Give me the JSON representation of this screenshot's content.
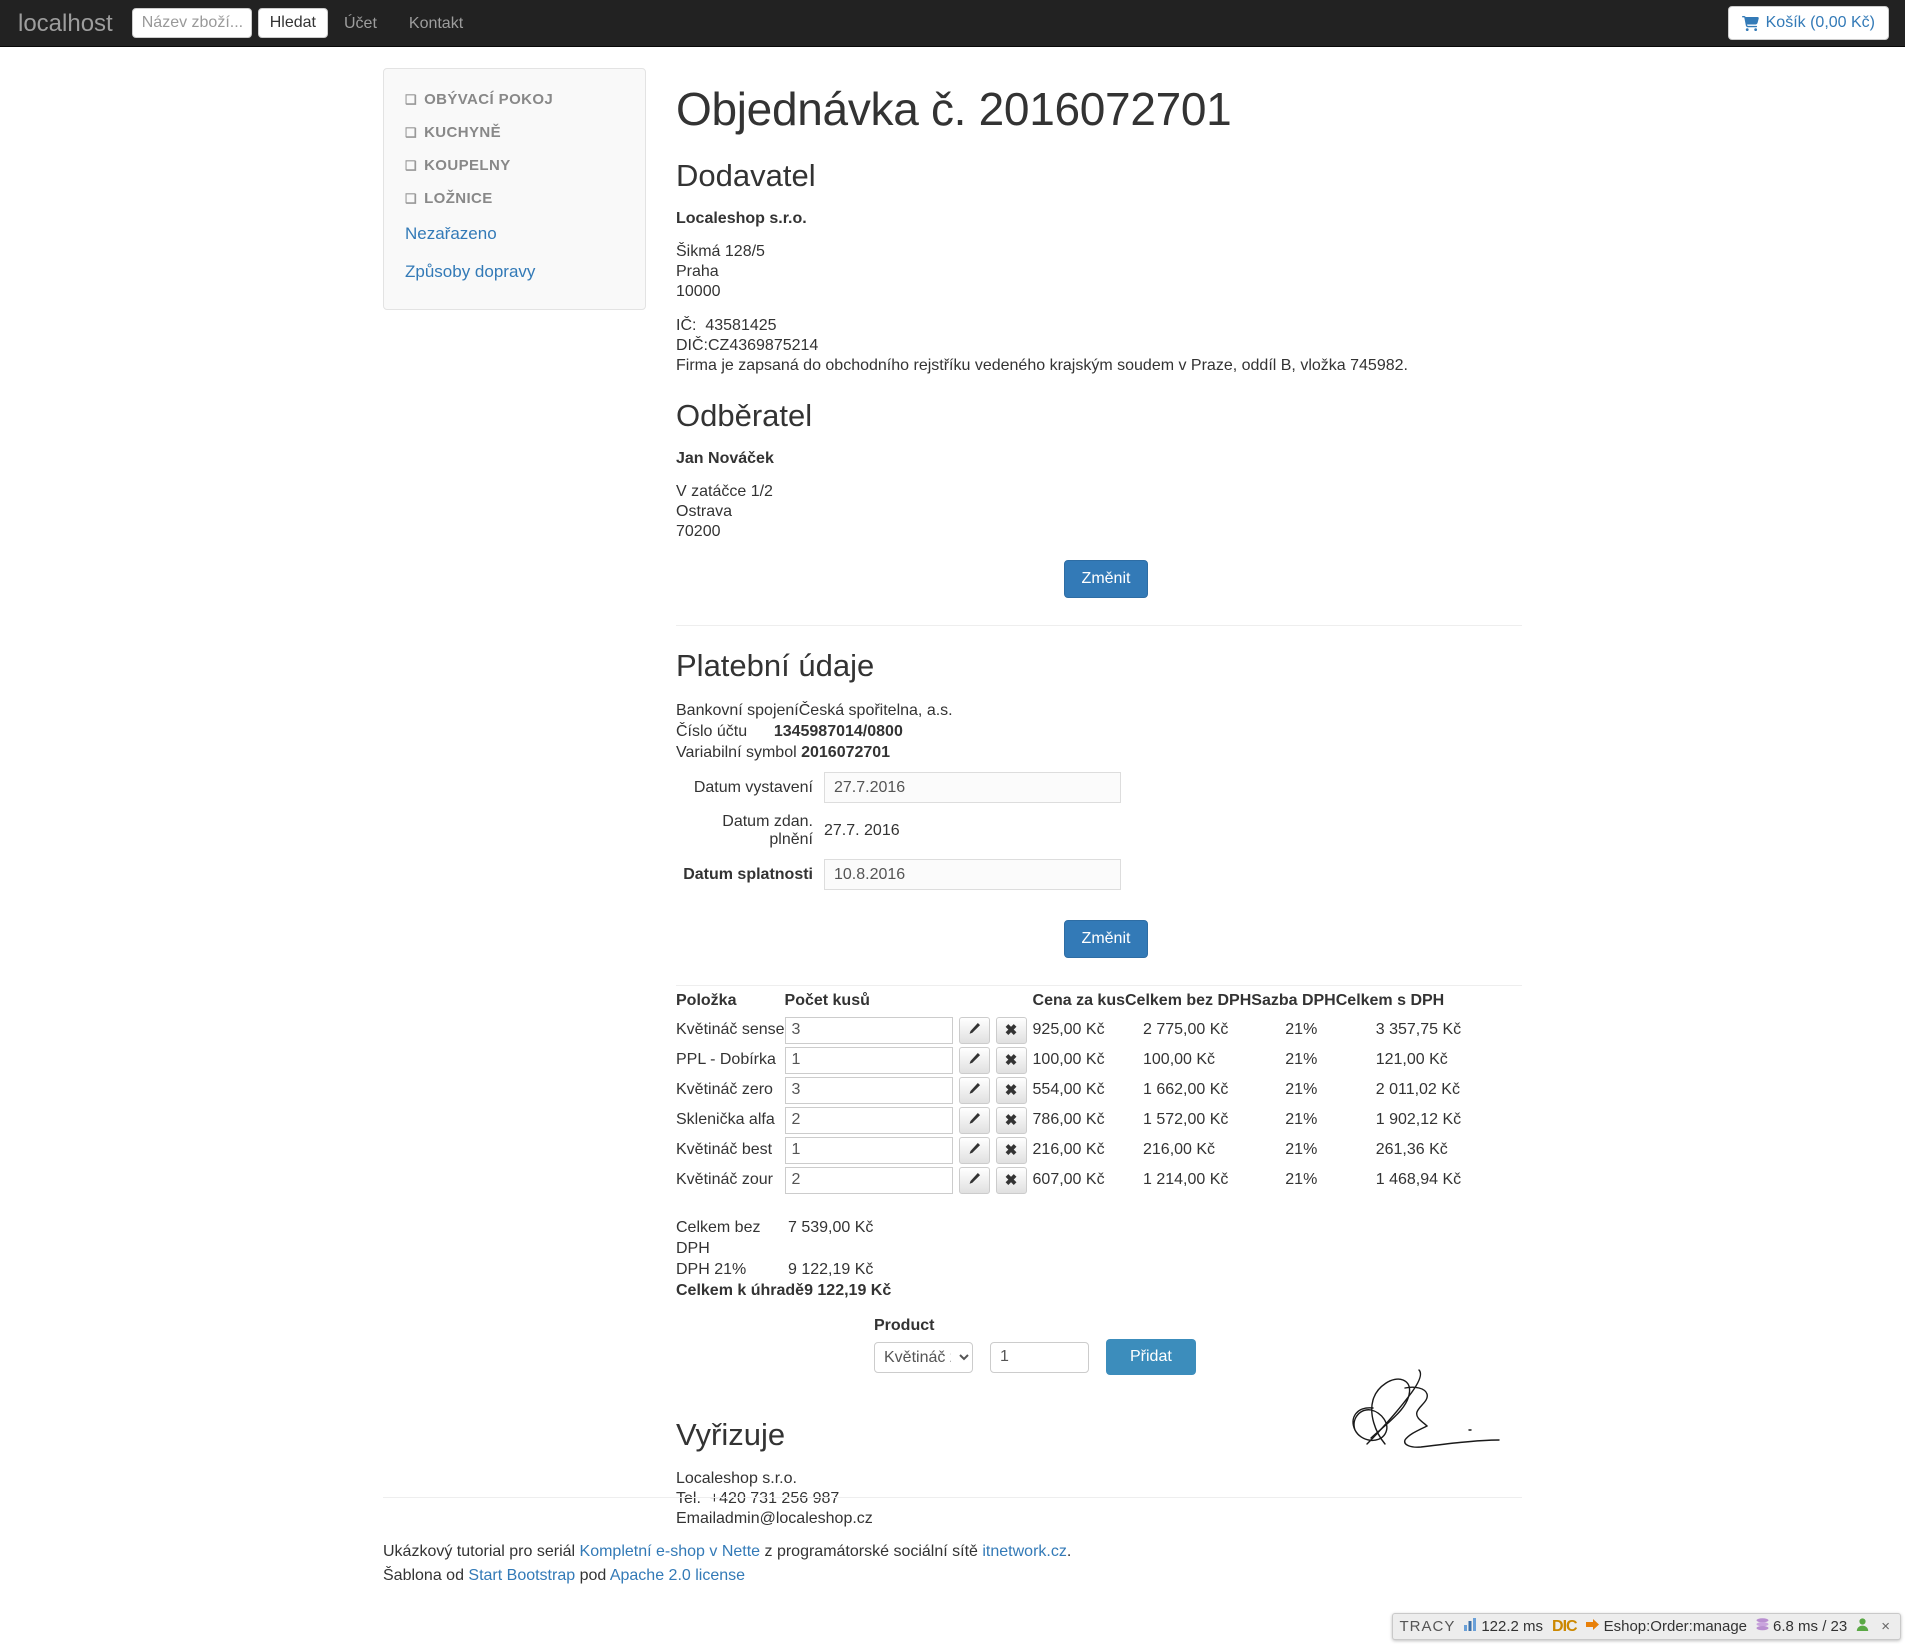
{
  "navbar": {
    "brand": "localhost",
    "search_placeholder": "Název zboží...",
    "search_value": "",
    "search_button": "Hledat",
    "links": [
      {
        "label": "Účet"
      },
      {
        "label": "Kontakt"
      }
    ],
    "cart_label": "Košík (0,00 Kč)",
    "cart_icon": "shopping-cart-icon"
  },
  "sidebar": {
    "categories": [
      {
        "label": "OBÝVACÍ POKOJ",
        "icon": "chevron-down-icon"
      },
      {
        "label": "KUCHYNĚ",
        "icon": "chevron-down-icon"
      },
      {
        "label": "KOUPELNY",
        "icon": "chevron-down-icon"
      },
      {
        "label": "LOŽNICE",
        "icon": "chevron-down-icon"
      }
    ],
    "links": [
      {
        "label": "Nezařazeno"
      },
      {
        "label": "Způsoby dopravy"
      }
    ]
  },
  "main": {
    "page_title": "Objednávka č. 2016072701",
    "supplier": {
      "heading": "Dodavatel",
      "name": "Localeshop s.r.o.",
      "street": "Šikmá 128/5",
      "city": "Praha",
      "zip": "10000",
      "ic_label": "IČ:",
      "ic_value": "43581425",
      "dic_label": "DIČ:",
      "dic_value": "CZ4369875214",
      "registry": "Firma je zapsaná do obchodního rejstříku vedeného krajským soudem v Praze, oddíl B, vložka 745982."
    },
    "customer": {
      "heading": "Odběratel",
      "name": "Jan Nováček",
      "street": "V zatáčce 1/2",
      "city": "Ostrava",
      "zip": "70200",
      "change_button": "Změnit"
    },
    "payment": {
      "heading": "Platební údaje",
      "bank_label": "Bankovní spojení",
      "bank_value": "Česká spořitelna, a.s.",
      "account_label": "Číslo účtu",
      "account_value": "1345987014/0800",
      "vs_label": "Variabilní symbol",
      "vs_value": "2016072701",
      "issue_date_label": "Datum vystavení",
      "issue_date_value": "27.7.2016",
      "taxable_date_label": "Datum zdan. plnění",
      "taxable_date_value": "27.7. 2016",
      "due_date_label": "Datum splatnosti",
      "due_date_value": "10.8.2016",
      "change_button": "Změnit"
    },
    "items_table": {
      "headers": [
        "Položka",
        "Počet kusů",
        "Cena za kus",
        "Celkem bez DPH",
        "Sazba DPH",
        "Celkem s DPH"
      ],
      "edit_icon": "pencil-icon",
      "delete_icon": "cross-icon",
      "rows": [
        {
          "item": "Květináč sense",
          "qty": "3",
          "unit_price": "925,00 Kč",
          "total_no_vat": "2 775,00 Kč",
          "vat_rate": "21%",
          "total_with_vat": "3 357,75 Kč"
        },
        {
          "item": "PPL - Dobírka",
          "qty": "1",
          "unit_price": "100,00 Kč",
          "total_no_vat": "100,00 Kč",
          "vat_rate": "21%",
          "total_with_vat": "121,00 Kč"
        },
        {
          "item": "Květináč zero",
          "qty": "3",
          "unit_price": "554,00 Kč",
          "total_no_vat": "1 662,00 Kč",
          "vat_rate": "21%",
          "total_with_vat": "2 011,02 Kč"
        },
        {
          "item": "Sklenička alfa",
          "qty": "2",
          "unit_price": "786,00 Kč",
          "total_no_vat": "1 572,00 Kč",
          "vat_rate": "21%",
          "total_with_vat": "1 902,12 Kč"
        },
        {
          "item": "Květináč best",
          "qty": "1",
          "unit_price": "216,00 Kč",
          "total_no_vat": "216,00 Kč",
          "vat_rate": "21%",
          "total_with_vat": "261,36 Kč"
        },
        {
          "item": "Květináč zour",
          "qty": "2",
          "unit_price": "607,00 Kč",
          "total_no_vat": "1 214,00 Kč",
          "vat_rate": "21%",
          "total_with_vat": "1 468,94 Kč"
        }
      ]
    },
    "totals": {
      "no_vat_label": "Celkem bez DPH",
      "no_vat_value": "7 539,00 Kč",
      "vat_label": "DPH 21%",
      "vat_value": "9 122,19 Kč",
      "grand_label": "Celkem k úhradě",
      "grand_value": "9 122,19 Kč"
    },
    "add_product": {
      "label": "Product",
      "selected_option": "Květináč zero",
      "quantity": "1",
      "button": "Přidat"
    },
    "handler": {
      "heading": "Vyřizuje",
      "company": "Localeshop s.r.o.",
      "tel_label": "Tel.",
      "tel_value": "+420 731 256 987",
      "email_label": "Email",
      "email_value": "admin@localeshop.cz"
    }
  },
  "footer": {
    "line1_pre": "Ukázkový tutorial pro seriál ",
    "line1_link1": "Kompletní e-shop v Nette",
    "line1_mid": " z programátorské sociální sítě ",
    "line1_link2": "itnetwork.cz",
    "line1_post": ".",
    "line2_pre": "Šablona od ",
    "line2_link1": "Start Bootstrap",
    "line2_mid": " pod ",
    "line2_link2": "Apache 2.0 license"
  },
  "tracy": {
    "label": "TRACY",
    "time": "122.2 ms",
    "dic": "DIC",
    "route": "Eshop:Order:manage",
    "db": "6.8 ms / 23",
    "chart_icon": "bar-chart-icon",
    "route_icon": "arrow-right-icon",
    "db_icon": "database-icon",
    "user_icon": "user-icon",
    "close_icon": "close-icon"
  },
  "colors": {
    "navbar_bg": "#222222",
    "accent_blue": "#337ab7",
    "add_blue": "#3c8dbc",
    "link_blue": "#337ab7",
    "sidebar_bg": "#f9f9f9"
  }
}
